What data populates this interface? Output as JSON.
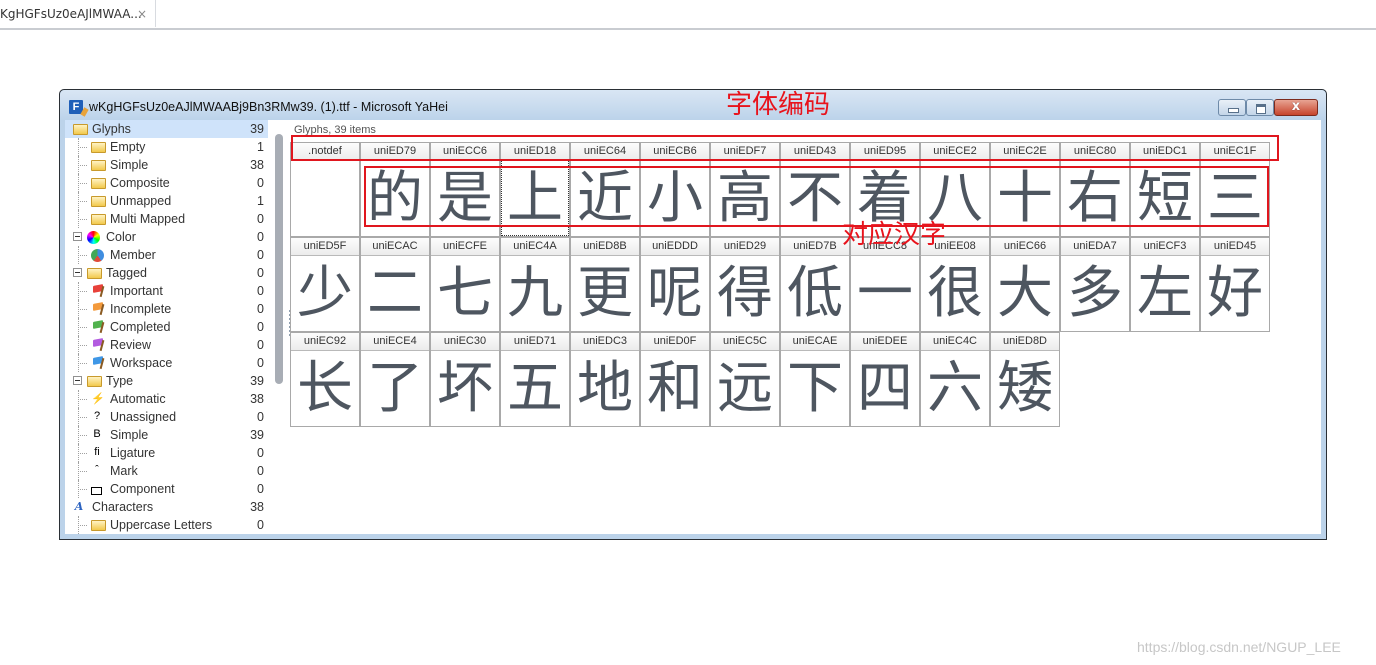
{
  "browser_tab": {
    "title": "KgHGFsUz0eAJlMWAA...",
    "close_icon": "×"
  },
  "window": {
    "title": "wKgHGFsUz0eAJlMWAABj9Bn3RMw39. (1).ttf - Microsoft YaHei",
    "app_icon": "F",
    "close_glyph": "x"
  },
  "sidebar": {
    "items": [
      {
        "label": "Glyphs",
        "count": "39",
        "icon": "folder-icon",
        "level": 0,
        "selected": true
      },
      {
        "label": "Empty",
        "count": "1",
        "icon": "folder-icon",
        "level": 1
      },
      {
        "label": "Simple",
        "count": "38",
        "icon": "folder-icon",
        "level": 1
      },
      {
        "label": "Composite",
        "count": "0",
        "icon": "folder-icon",
        "level": 1
      },
      {
        "label": "Unmapped",
        "count": "1",
        "icon": "folder-icon",
        "level": 1
      },
      {
        "label": "Multi Mapped",
        "count": "0",
        "icon": "folder-icon",
        "level": 1
      },
      {
        "label": "Color",
        "count": "0",
        "icon": "color-wheel-icon",
        "level": 0
      },
      {
        "label": "Member",
        "count": "0",
        "icon": "member-icon",
        "level": 1
      },
      {
        "label": "Tagged",
        "count": "0",
        "icon": "folder-icon",
        "level": 0
      },
      {
        "label": "Important",
        "count": "0",
        "icon": "flag-red-icon",
        "level": 1
      },
      {
        "label": "Incomplete",
        "count": "0",
        "icon": "flag-orange-icon",
        "level": 1
      },
      {
        "label": "Completed",
        "count": "0",
        "icon": "flag-green-icon",
        "level": 1
      },
      {
        "label": "Review",
        "count": "0",
        "icon": "flag-purple-icon",
        "level": 1
      },
      {
        "label": "Workspace",
        "count": "0",
        "icon": "flag-blue-icon",
        "level": 1
      },
      {
        "label": "Type",
        "count": "39",
        "icon": "folder-icon",
        "level": 0
      },
      {
        "label": "Automatic",
        "count": "38",
        "icon": "lightning-icon",
        "level": 1
      },
      {
        "label": "Unassigned",
        "count": "0",
        "icon": "question-icon",
        "level": 1
      },
      {
        "label": "Simple",
        "count": "39",
        "icon": "letter-b-icon",
        "level": 1
      },
      {
        "label": "Ligature",
        "count": "0",
        "icon": "ligature-fi-icon",
        "level": 1
      },
      {
        "label": "Mark",
        "count": "0",
        "icon": "caret-mark-icon",
        "level": 1
      },
      {
        "label": "Component",
        "count": "0",
        "icon": "component-icon",
        "level": 1
      },
      {
        "label": "Characters",
        "count": "38",
        "icon": "characters-a-icon",
        "level": 0
      },
      {
        "label": "Uppercase Letters",
        "count": "0",
        "icon": "folder-icon",
        "level": 1
      }
    ],
    "icon_glyphs": {
      "lightning": "⚡",
      "question": "?",
      "letter_b": "B",
      "ligature": "ﬁ",
      "mark": "ˆ",
      "characters": "A"
    },
    "flag_colors": {
      "red": "#e8413a",
      "orange": "#f39a3c",
      "green": "#52b24e",
      "purple": "#b35be0",
      "blue": "#3f97e6"
    }
  },
  "grid": {
    "caption": "Glyphs, 39 items",
    "focused_index": 3,
    "glyphs": [
      {
        "name": ".notdef",
        "char": ""
      },
      {
        "name": "uniED79",
        "char": "的"
      },
      {
        "name": "uniECC6",
        "char": "是"
      },
      {
        "name": "uniED18",
        "char": "上"
      },
      {
        "name": "uniEC64",
        "char": "近"
      },
      {
        "name": "uniECB6",
        "char": "小"
      },
      {
        "name": "uniEDF7",
        "char": "高"
      },
      {
        "name": "uniED43",
        "char": "不"
      },
      {
        "name": "uniED95",
        "char": "着"
      },
      {
        "name": "uniECE2",
        "char": "八"
      },
      {
        "name": "uniEC2E",
        "char": "十"
      },
      {
        "name": "uniEC80",
        "char": "右"
      },
      {
        "name": "uniEDC1",
        "char": "短"
      },
      {
        "name": "uniEC1F",
        "char": "三"
      },
      {
        "name": "uniED5F",
        "char": "少"
      },
      {
        "name": "uniECAC",
        "char": "二"
      },
      {
        "name": "uniECFE",
        "char": "七"
      },
      {
        "name": "uniEC4A",
        "char": "九"
      },
      {
        "name": "uniED8B",
        "char": "更"
      },
      {
        "name": "uniEDDD",
        "char": "呢"
      },
      {
        "name": "uniED29",
        "char": "得"
      },
      {
        "name": "uniED7B",
        "char": "低"
      },
      {
        "name": "uniECC8",
        "char": "一"
      },
      {
        "name": "uniEE08",
        "char": "很"
      },
      {
        "name": "uniEC66",
        "char": "大"
      },
      {
        "name": "uniEDA7",
        "char": "多"
      },
      {
        "name": "uniECF3",
        "char": "左"
      },
      {
        "name": "uniED45",
        "char": "好"
      },
      {
        "name": "uniEC92",
        "char": "长"
      },
      {
        "name": "uniECE4",
        "char": "了"
      },
      {
        "name": "uniEC30",
        "char": "坏"
      },
      {
        "name": "uniED71",
        "char": "五"
      },
      {
        "name": "uniEDC3",
        "char": "地"
      },
      {
        "name": "uniED0F",
        "char": "和"
      },
      {
        "name": "uniEC5C",
        "char": "远"
      },
      {
        "name": "uniECAE",
        "char": "下"
      },
      {
        "name": "uniEDEE",
        "char": "四"
      },
      {
        "name": "uniEC4C",
        "char": "六"
      },
      {
        "name": "uniED8D",
        "char": "矮"
      }
    ]
  },
  "annotations": {
    "font_code_label": "字体编码",
    "chinese_char_label": "对应汉字",
    "color": "#e0161e"
  },
  "watermark": "https://blog.csdn.net/NGUP_LEE"
}
